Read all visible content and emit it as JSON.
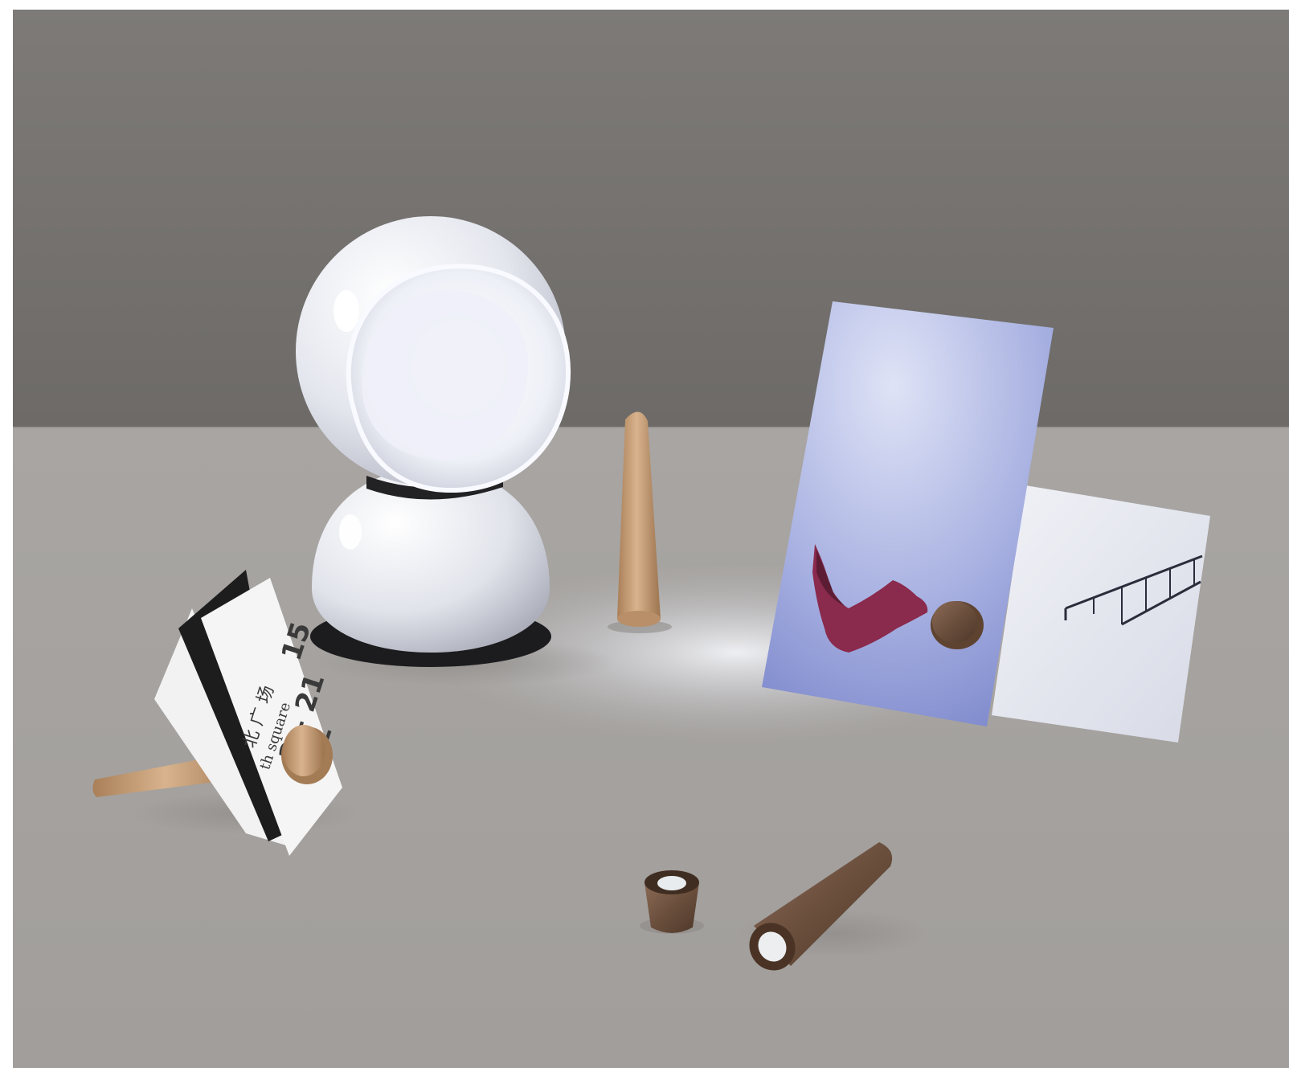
{
  "scene": {
    "type": "product-photo",
    "palette": {
      "wall": "#7b7875",
      "table": "#a9a6a3",
      "lamp": "#eef0f6",
      "wood_light": "#c39a72",
      "wood_dark": "#6a4e3c",
      "postcard": "#8e9ad6"
    }
  },
  "card": {
    "line1": "北 广 场",
    "line2": "th square",
    "line3": "15",
    "line4": "2 – 21",
    "line5": "2 – "
  }
}
